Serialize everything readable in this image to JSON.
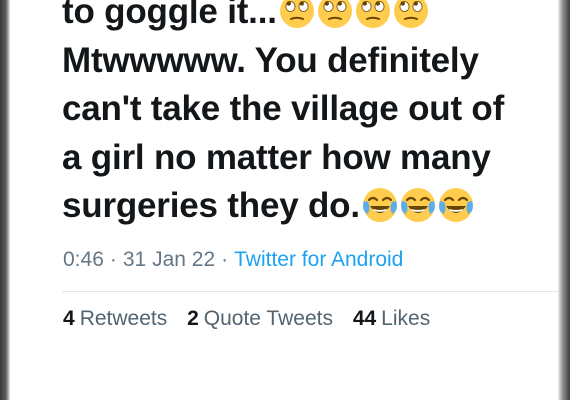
{
  "tweet": {
    "lines": [
      "to goggle it...",
      "Mtwwwww. You definitely",
      "can't take the village out of",
      "a girl no matter how many",
      "surgeries they do."
    ],
    "line1_emoji": "rolling-eyes-face",
    "line5_emoji": "tears-of-joy-face"
  },
  "meta": {
    "time": "0:46",
    "separator": "·",
    "date": "31 Jan 22",
    "source": "Twitter for Android"
  },
  "stats": {
    "retweets": {
      "count": "4",
      "label": "Retweets"
    },
    "quotes": {
      "count": "2",
      "label": "Quote Tweets"
    },
    "likes": {
      "count": "44",
      "label": "Likes"
    }
  },
  "colors": {
    "text": "#14171a",
    "meta_gray": "#657786",
    "link_blue": "#1da1f2",
    "divider": "#e1e8ed"
  }
}
